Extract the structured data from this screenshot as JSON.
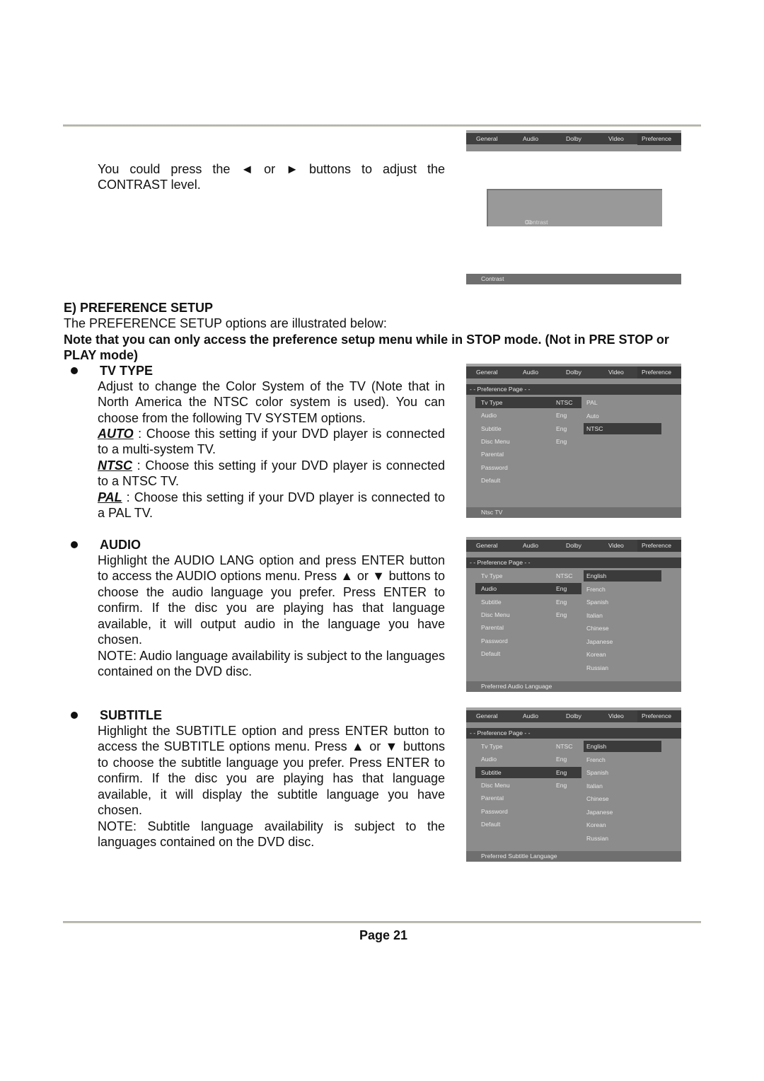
{
  "contrast_section": {
    "text": "You could press the ◄ or ► buttons to adjust the CONTRAST level.",
    "osd": {
      "tabs": [
        "General",
        "Audio",
        "Dolby",
        "Video",
        "Preference"
      ],
      "contrast_label": "Contrast",
      "contrast_value": "00",
      "footer": "Contrast"
    }
  },
  "preference": {
    "heading": "E) PREFERENCE SETUP",
    "intro": "The PREFERENCE SETUP options are illustrated below:",
    "note": "Note that you can only access the preference setup menu while in STOP mode. (Not in PRE STOP or PLAY mode)"
  },
  "tv_type": {
    "heading": "TV TYPE",
    "body": "Adjust to change the Color System of the TV (Note that in North America the NTSC color system is used). You can choose from the following TV SYSTEM options.",
    "options": [
      {
        "key": "AUTO",
        "desc": " : Choose this setting if your DVD player is connected to a multi-system TV."
      },
      {
        "key": "NTSC",
        "desc": " : Choose this setting if your DVD player is connected to a NTSC TV."
      },
      {
        "key": "PAL",
        "desc": " : Choose this setting if your DVD player is connected to a PAL TV."
      }
    ]
  },
  "audio": {
    "heading": "AUDIO",
    "body": "Highlight the AUDIO LANG option and press ENTER button to access the AUDIO options menu. Press ▲ or ▼ buttons to choose the audio language you prefer. Press ENTER to confirm. If the disc you are playing has that language available, it will output audio in the language you have chosen.",
    "note": "NOTE: Audio language availability is subject to the languages contained on the DVD disc."
  },
  "subtitle": {
    "heading": "SUBTITLE",
    "body": "Highlight the SUBTITLE option and press ENTER button to access the SUBTITLE options menu. Press ▲ or ▼ buttons to choose the subtitle language you prefer. Press ENTER to confirm. If the disc you are playing has that language available, it will display the subtitle language you have chosen.",
    "note": "NOTE: Subtitle language availability is subject to the languages contained on the DVD disc."
  },
  "osd_common": {
    "tabs": [
      "General",
      "Audio",
      "Dolby",
      "Video",
      "Preference"
    ],
    "page_header": "- -  Preference  Page  - -",
    "rows": [
      {
        "label": "Tv Type",
        "value": "NTSC"
      },
      {
        "label": "Audio",
        "value": "Eng"
      },
      {
        "label": "Subtitle",
        "value": "Eng"
      },
      {
        "label": "Disc Menu",
        "value": "Eng"
      },
      {
        "label": "Parental",
        "value": ""
      },
      {
        "label": "Password",
        "value": ""
      },
      {
        "label": "Default",
        "value": ""
      }
    ]
  },
  "osd_tvtype": {
    "options": [
      "PAL",
      "Auto",
      "NTSC"
    ],
    "selected_row": "Tv Type",
    "selected_option": "NTSC",
    "footer": "Ntsc TV"
  },
  "osd_audio": {
    "options": [
      "English",
      "French",
      "Spanish",
      "Italian",
      "Chinese",
      "Japanese",
      "Korean",
      "Russian"
    ],
    "selected_row": "Audio",
    "selected_option": "English",
    "footer": "Preferred  Audio  Language"
  },
  "osd_subtitle": {
    "options": [
      "English",
      "French",
      "Spanish",
      "Italian",
      "Chinese",
      "Japanese",
      "Korean",
      "Russian"
    ],
    "selected_row": "Subtitle",
    "selected_option": "English",
    "footer": "Preferred  Subtitle  Language"
  },
  "footer": {
    "page_label": "Page 21"
  }
}
